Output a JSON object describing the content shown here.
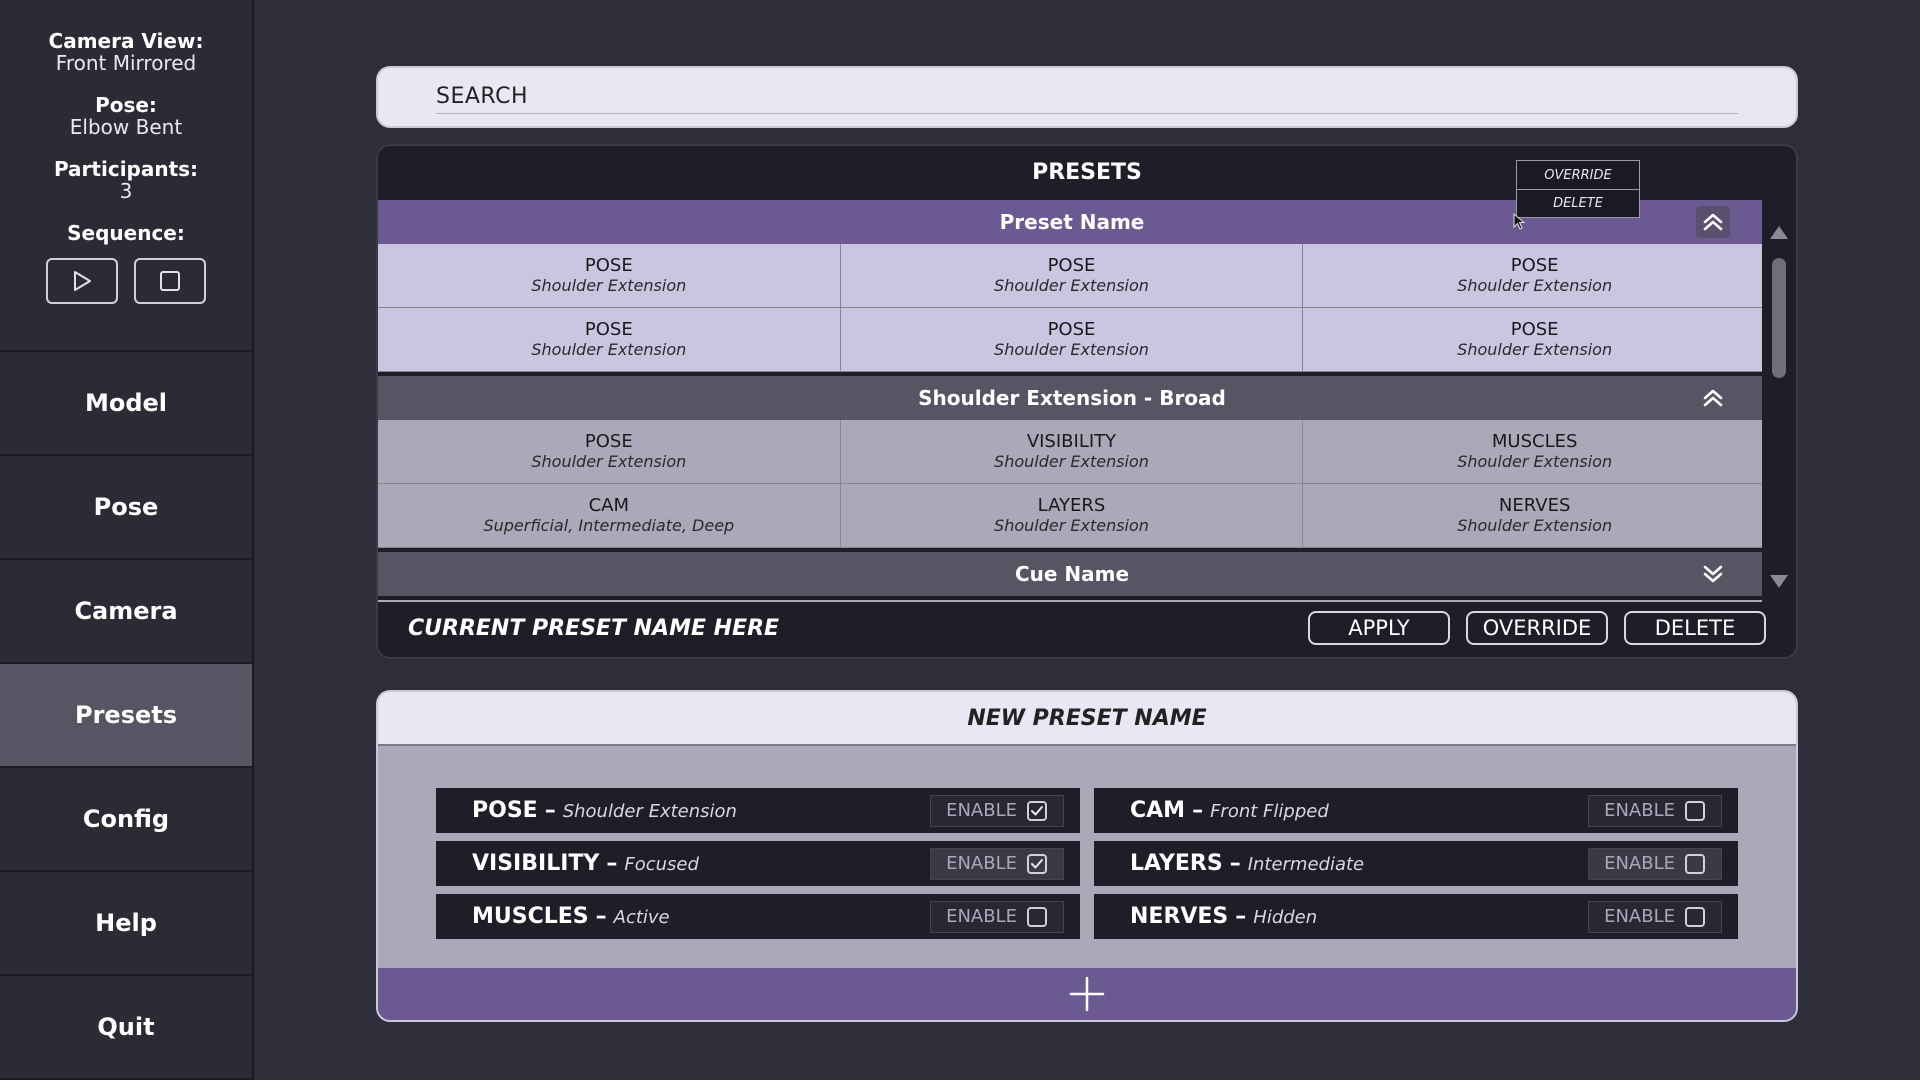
{
  "sidebar": {
    "info": {
      "camera_view_label": "Camera View:",
      "camera_view_value": "Front Mirrored",
      "pose_label": "Pose:",
      "pose_value": "Elbow Bent",
      "participants_label": "Participants:",
      "participants_value": "3",
      "sequence_label": "Sequence:"
    },
    "nav": [
      "Model",
      "Pose",
      "Camera",
      "Presets",
      "Config",
      "Help",
      "Quit"
    ],
    "active": "Presets"
  },
  "search": {
    "placeholder": "SEARCH"
  },
  "presets": {
    "title": "PRESETS",
    "groups": [
      {
        "name": "Preset Name",
        "cells": [
          {
            "title": "POSE",
            "sub": "Shoulder Extension"
          },
          {
            "title": "POSE",
            "sub": "Shoulder Extension"
          },
          {
            "title": "POSE",
            "sub": "Shoulder Extension"
          },
          {
            "title": "POSE",
            "sub": "Shoulder Extension"
          },
          {
            "title": "POSE",
            "sub": "Shoulder Extension"
          },
          {
            "title": "POSE",
            "sub": "Shoulder Extension"
          }
        ]
      },
      {
        "name": "Shoulder Extension - Broad",
        "cells": [
          {
            "title": "POSE",
            "sub": "Shoulder Extension"
          },
          {
            "title": "VISIBILITY",
            "sub": "Shoulder Extension"
          },
          {
            "title": "MUSCLES",
            "sub": "Shoulder Extension"
          },
          {
            "title": "CAM",
            "sub": "Superficial, Intermediate, Deep"
          },
          {
            "title": "LAYERS",
            "sub": "Shoulder Extension"
          },
          {
            "title": "NERVES",
            "sub": "Shoulder Extension"
          }
        ]
      },
      {
        "name": "Cue Name"
      }
    ],
    "context_menu": [
      "OVERRIDE",
      "DELETE"
    ],
    "current_name": "CURRENT PRESET NAME HERE",
    "buttons": {
      "apply": "APPLY",
      "override": "OVERRIDE",
      "delete": "DELETE"
    }
  },
  "new_preset": {
    "title": "NEW PRESET NAME",
    "enable_label": "ENABLE",
    "options": [
      {
        "name": "POSE",
        "value": "Shoulder Extension",
        "checked": true
      },
      {
        "name": "CAM",
        "value": "Front Flipped",
        "checked": false
      },
      {
        "name": "VISIBILITY",
        "value": "Focused",
        "checked": true
      },
      {
        "name": "LAYERS",
        "value": "Intermediate",
        "checked": false
      },
      {
        "name": "MUSCLES",
        "value": "Active",
        "checked": false
      },
      {
        "name": "NERVES",
        "value": "Hidden",
        "checked": false
      }
    ]
  },
  "colors": {
    "accent_purple": "#6b5a91",
    "background": "#2e2e3a",
    "panel_dark": "#1e1e28",
    "cell_light": "#c9c6e2",
    "cell_grey": "#a9a9b9"
  },
  "icons": {
    "play": "play-icon",
    "stop": "stop-icon",
    "collapse": "double-chevron-up-icon",
    "expand": "double-chevron-down-icon",
    "add": "plus-icon",
    "check": "checkmark-icon"
  }
}
